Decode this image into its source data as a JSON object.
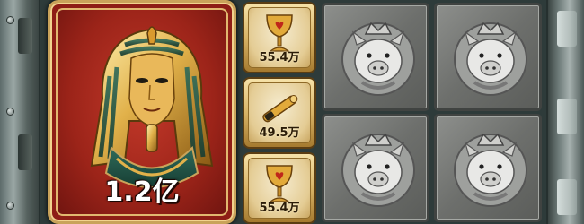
{
  "game": {
    "grand_tile": {
      "symbol": "pharaoh-mask",
      "value": "1.2亿"
    },
    "prizes": [
      {
        "symbol": "golden-goblet",
        "value": "55.4万"
      },
      {
        "symbol": "golden-scroll",
        "value": "49.5万"
      },
      {
        "symbol": "golden-goblet",
        "value": "55.4万"
      }
    ],
    "reel_symbols": [
      "silver-pig-coin",
      "silver-pig-coin",
      "silver-pig-coin",
      "silver-pig-coin"
    ]
  }
}
